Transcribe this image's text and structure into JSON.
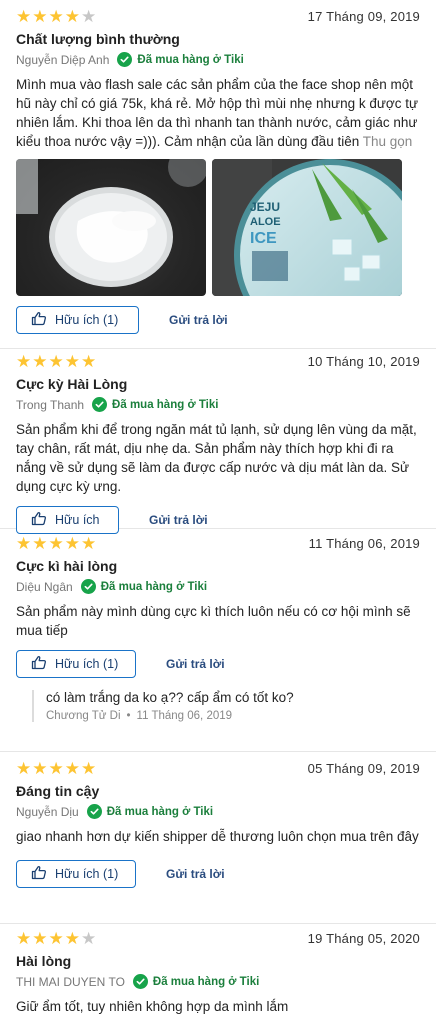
{
  "reviews": [
    {
      "rating": 4,
      "date": "17 Tháng 09, 2019",
      "title": "Chất lượng bình thường",
      "author": "Nguyễn Diệp Anh",
      "badge": "Đã mua hàng ở Tiki",
      "content": "Mình mua vào flash sale các sản phẩm của the face shop nên một hũ này chỉ có giá 75k, khá rẻ. Mở hộp thì mùi nhẹ nhưng k được tự nhiên lắm. Khi thoa lên da thì nhanh tan thành nước, cảm giác như kiểu thoa nước vậy =))). Cảm nhận của lần dùng đầu tiên",
      "collapse_label": "Thu gọn",
      "product_label": [
        "JEJU",
        "ALOE",
        "ICE"
      ],
      "helpful_label": "Hữu ích (1)",
      "reply_label": "Gửi trả lời"
    },
    {
      "rating": 5,
      "date": "10 Tháng 10, 2019",
      "title": "Cực kỳ Hài Lòng",
      "author": "Trong Thanh",
      "badge": "Đã mua hàng ở Tiki",
      "content": "Sản phẩm khi để trong ngăn mát tủ lạnh, sử dụng lên vùng da mặt, tay chân, rất mát, dịu nhẹ da. Sản phẩm này thích hợp khi đi ra nắng về sử dụng sẽ làm da được cấp nước và dịu mát làn da. Sử dụng cực kỳ ưng.",
      "helpful_label": "Hữu ích",
      "reply_label": "Gửi trả lời"
    },
    {
      "rating": 5,
      "date": "11 Tháng 06, 2019",
      "title": "Cực kì hài lòng",
      "author": "Diệu Ngân",
      "badge": "Đã mua hàng ở Tiki",
      "content": "Sản phẩm này mình dùng cực kì thích luôn nếu có cơ hội mình sẽ mua tiếp",
      "helpful_label": "Hữu ích (1)",
      "reply_label": "Gửi trả lời",
      "comment": {
        "text": "có làm trắng da ko ạ?? cấp ẩm có tốt ko?",
        "author": "Chương Tử Di",
        "separator": "•",
        "date": "11 Tháng 06, 2019"
      }
    },
    {
      "rating": 5,
      "date": "05 Tháng 09, 2019",
      "title": "Đáng tin cậy",
      "author": "Nguyễn Dịu",
      "badge": "Đã mua hàng ở Tiki",
      "content": "giao nhanh hơn dự kiến shipper dễ thương luôn chọn mua trên đây",
      "helpful_label": "Hữu ích (1)",
      "reply_label": "Gửi trả lời"
    },
    {
      "rating": 4,
      "date": "19 Tháng 05, 2020",
      "title": "Hài lòng",
      "author": "THI MAI DUYEN TO",
      "badge": "Đã mua hàng ở Tiki",
      "content": "Giữ ẩm tốt, tuy nhiên không hợp da mình lắm"
    }
  ],
  "colors": {
    "star_on": "#fdc432",
    "star_off": "#c7c7c7",
    "badge_green": "#17a34a",
    "button_border": "#1a73c8"
  }
}
